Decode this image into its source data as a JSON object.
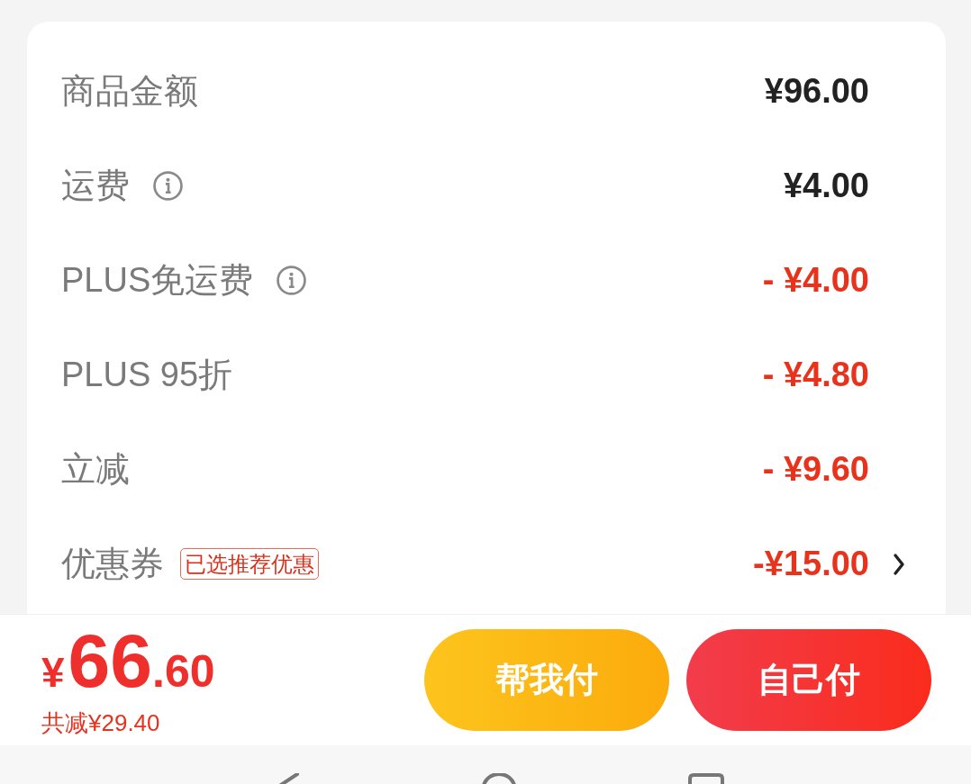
{
  "summary": {
    "rows": [
      {
        "label": "商品金额",
        "info": false,
        "amount": "¥96.00",
        "kind": "charge",
        "chevron": false
      },
      {
        "label": "运费",
        "info": true,
        "amount": "¥4.00",
        "kind": "charge",
        "chevron": false
      },
      {
        "label": "PLUS免运费",
        "info": true,
        "amount": "- ¥4.00",
        "kind": "discount",
        "chevron": false
      },
      {
        "label": "PLUS 95折",
        "info": false,
        "amount": "- ¥4.80",
        "kind": "discount",
        "chevron": false
      },
      {
        "label": "立减",
        "info": false,
        "amount": "- ¥9.60",
        "kind": "discount",
        "chevron": false
      },
      {
        "label": "优惠券",
        "tag": "已选推荐优惠",
        "info": false,
        "amount": "-¥15.00",
        "kind": "discount",
        "chevron": true
      }
    ]
  },
  "checkout_bar": {
    "total": {
      "currency": "¥",
      "integer": "66",
      "fraction": ".60"
    },
    "savings": "共减¥29.40",
    "buttons": [
      {
        "label": "帮我付",
        "kind": "secondary"
      },
      {
        "label": "自己付",
        "kind": "primary"
      }
    ]
  }
}
